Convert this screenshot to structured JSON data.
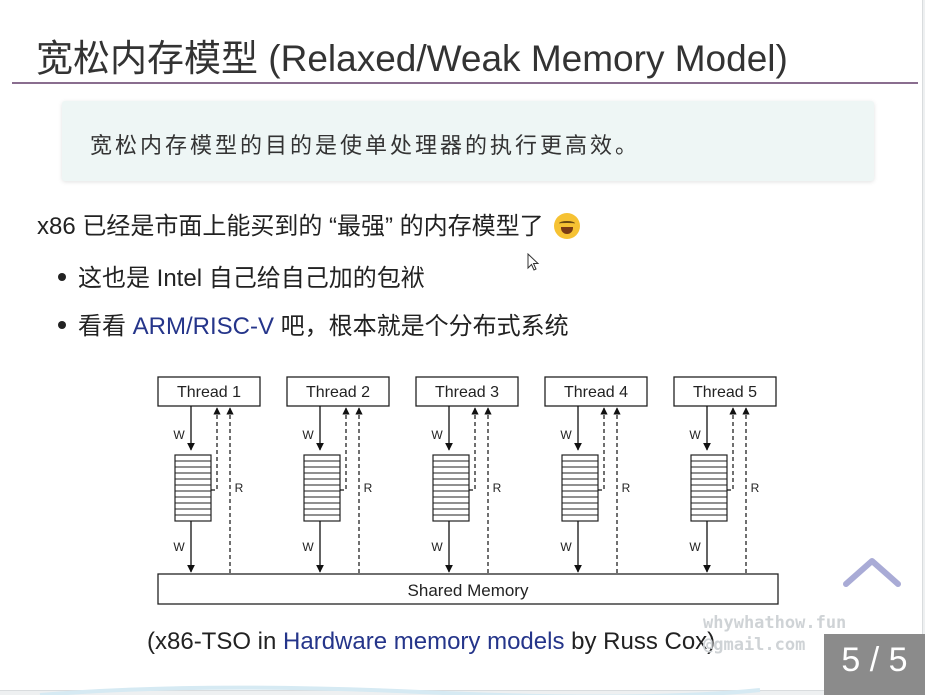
{
  "slide": {
    "title": "宽松内存模型 (Relaxed/Weak Memory Model)",
    "callout": "宽松内存模型的目的是使单处理器的执行更高效。",
    "lead": "x86 已经是市面上能买到的 “最强” 的内存模型了",
    "lead_emoji": "laughing-tears-emoji",
    "bullets": [
      {
        "text": "这也是 Intel 自己给自己加的包袱"
      },
      {
        "pre": "看看 ",
        "link": "ARM/RISC-V",
        "post": " 吧，根本就是个分布式系统"
      }
    ],
    "caption": {
      "pre": "(x86-TSO in ",
      "link": "Hardware memory models",
      "post": " by Russ Cox)"
    },
    "page_counter": "5 / 5",
    "watermark": [
      "whywhathow.fun",
      "@gmail.com"
    ]
  },
  "diagram": {
    "threads": [
      "Thread 1",
      "Thread 2",
      "Thread 3",
      "Thread 4",
      "Thread 5"
    ],
    "write_label": "W",
    "read_label": "R",
    "memory_label": "Shared Memory"
  },
  "colors": {
    "title_rule": "#8a6d8f",
    "callout_bg": "#eef6f5",
    "link": "#25358a",
    "nav_chevron": "#a9abd6",
    "counter_bg": "#8b8b8b"
  }
}
